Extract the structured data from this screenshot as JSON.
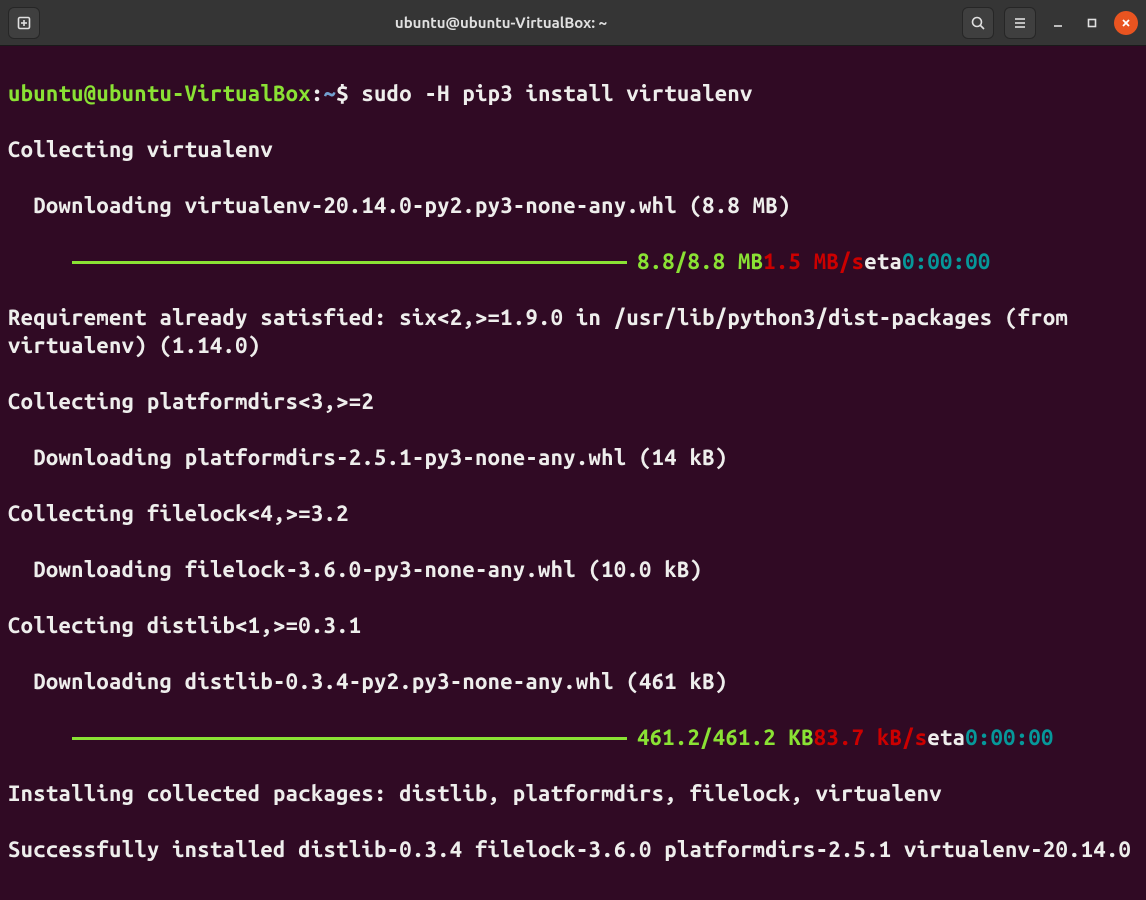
{
  "window": {
    "title": "ubuntu@ubuntu-VirtualBox: ~"
  },
  "prompt": {
    "user_host": "ubuntu@ubuntu-VirtualBox",
    "colon": ":",
    "cwd": "~",
    "dollar": "$",
    "command": " sudo -H pip3 install virtualenv"
  },
  "out": {
    "l1": "Collecting virtualenv",
    "l2": "  Downloading virtualenv-20.14.0-py2.py3-none-any.whl (8.8 MB)",
    "p1_size": "8.8/8.8 MB",
    "p1_speed": "1.5 MB/s",
    "p1_eta_lbl": "eta",
    "p1_eta": "0:00:00",
    "l3": "Requirement already satisfied: six<2,>=1.9.0 in /usr/lib/python3/dist-packages (from virtualenv) (1.14.0)",
    "l4": "Collecting platformdirs<3,>=2",
    "l5": "  Downloading platformdirs-2.5.1-py3-none-any.whl (14 kB)",
    "l6": "Collecting filelock<4,>=3.2",
    "l7": "  Downloading filelock-3.6.0-py3-none-any.whl (10.0 kB)",
    "l8": "Collecting distlib<1,>=0.3.1",
    "l9": "  Downloading distlib-0.3.4-py2.py3-none-any.whl (461 kB)",
    "p2_size": "461.2/461.2 KB",
    "p2_speed": "83.7 kB/s",
    "p2_eta_lbl": "eta",
    "p2_eta": "0:00:00",
    "l10": "Installing collected packages: distlib, platformdirs, filelock, virtualenv",
    "l11": "Successfully installed distlib-0.3.4 filelock-3.6.0 platformdirs-2.5.1 virtualenv-20.14.0"
  }
}
